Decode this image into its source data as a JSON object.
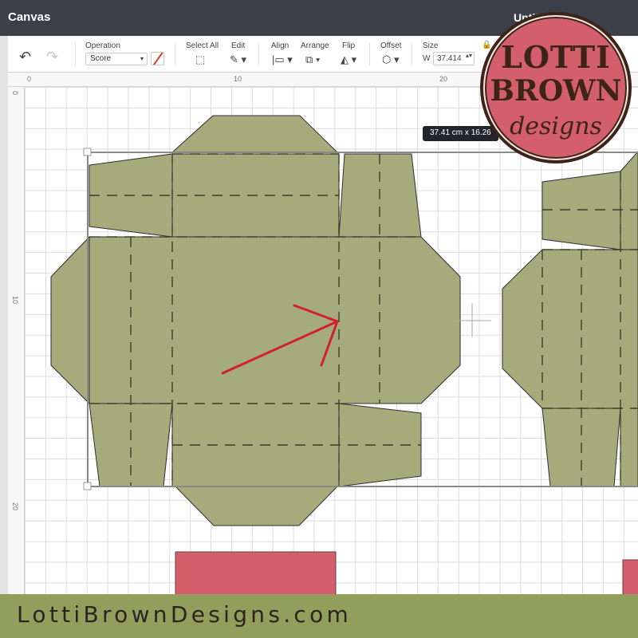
{
  "titlebar": {
    "app_title": "Canvas",
    "document_title": "Untitled"
  },
  "toolbar": {
    "undo_icon": "undo-icon",
    "redo_icon": "redo-icon",
    "operation": {
      "label": "Operation",
      "value": "Score",
      "caret": "▾",
      "color": "#d0402a"
    },
    "select_all": {
      "label": "Select All",
      "icon": "⬚"
    },
    "edit": {
      "label": "Edit",
      "icon": "✎ ▾"
    },
    "align": {
      "label": "Align",
      "icon": "|▭ ▾"
    },
    "arrange": {
      "label": "Arrange",
      "icon": "⧉ ▾"
    },
    "flip": {
      "label": "Flip",
      "icon": "◭ ▾"
    },
    "offset": {
      "label": "Offset",
      "icon": "⬡ ▾"
    },
    "size": {
      "label": "Size",
      "w_label": "W",
      "w_value": "37.414",
      "spin": "▴▾",
      "lock_icon": "🔒"
    }
  },
  "rulers": {
    "top": [
      "0",
      "10",
      "20"
    ],
    "left": [
      "0",
      "10",
      "20"
    ]
  },
  "selection": {
    "dimension_tooltip": "37.41  cm x 16.26"
  },
  "colors": {
    "shape_fill": "#a6ab7c",
    "shape_stroke": "#2f2f2f",
    "score_line": "#3a3f2a",
    "arrow": "#d1202e",
    "pink_shape": "#d35f6d",
    "footer_bg": "#919e5c",
    "titlebar_bg": "#3b4048"
  },
  "logo": {
    "line1": "LOTTI",
    "line2": "BROWN",
    "line3": "designs"
  },
  "footer": {
    "url": "LottiBrownDesigns.com"
  }
}
